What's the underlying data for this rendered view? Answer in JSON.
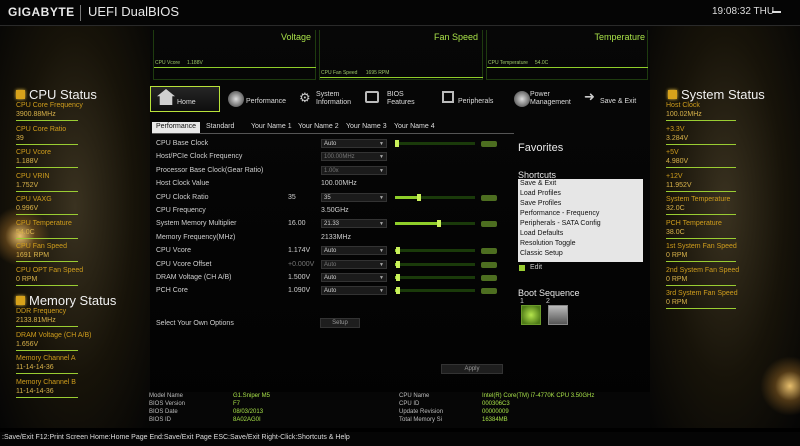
{
  "header": {
    "brand": "GIGABYTE",
    "product": "UEFI DualBIOS",
    "clock": "19:08:32 THU"
  },
  "graphs": {
    "voltage": {
      "title": "Voltage",
      "label": "CPU Vcore",
      "value": "1.188V"
    },
    "fan_speed": {
      "title": "Fan Speed",
      "label": "CPU Fan Speed",
      "value": "1695 RPM"
    },
    "temperature": {
      "title": "Temperature",
      "label": "CPU Temperature",
      "value": "54.0C"
    }
  },
  "nav": {
    "home": "Home",
    "performance": "Performance",
    "system_information": "System Information",
    "bios_features": "BIOS Features",
    "peripherals": "Peripherals",
    "power_management": "Power Management",
    "save_exit": "Save & Exit"
  },
  "subtabs": [
    "Performance",
    "Standard",
    "Your Name 1",
    "Your Name 2",
    "Your Name 3",
    "Your Name 4"
  ],
  "cpu_status": {
    "title": "CPU Status",
    "items": [
      {
        "label": "CPU Core Frequency",
        "value": "3900.88MHz"
      },
      {
        "label": "CPU Core Ratio",
        "value": "39"
      },
      {
        "label": "CPU Vcore",
        "value": "1.188V"
      },
      {
        "label": "CPU VRIN",
        "value": "1.752V"
      },
      {
        "label": "CPU VAXG",
        "value": "0.996V"
      },
      {
        "label": "CPU Temperature",
        "value": "54.0C"
      },
      {
        "label": "CPU Fan Speed",
        "value": "1691 RPM"
      },
      {
        "label": "CPU OPT Fan Speed",
        "value": "0 RPM"
      }
    ]
  },
  "memory_status": {
    "title": "Memory Status",
    "items": [
      {
        "label": "DDR Frequency",
        "value": "2133.81MHz"
      },
      {
        "label": "DRAM Voltage      (CH A/B)",
        "value": "1.656V"
      },
      {
        "label": "Memory Channel A",
        "value": "11-14-14-36"
      },
      {
        "label": "Memory Channel B",
        "value": "11-14-14-36"
      }
    ]
  },
  "system_status": {
    "title": "System Status",
    "items": [
      {
        "label": "Host Clock",
        "value": "100.02MHz"
      },
      {
        "label": "+3.3V",
        "value": "3.284V"
      },
      {
        "label": "+5V",
        "value": "4.980V"
      },
      {
        "label": "+12V",
        "value": "11.952V"
      },
      {
        "label": "System Temperature",
        "value": "32.0C"
      },
      {
        "label": "PCH Temperature",
        "value": "38.0C"
      },
      {
        "label": "1st System Fan Speed",
        "value": "0 RPM"
      },
      {
        "label": "2nd System Fan Speed",
        "value": "0 RPM"
      },
      {
        "label": "3rd System Fan Speed",
        "value": "0 RPM"
      }
    ]
  },
  "settings": [
    {
      "label": "CPU Base Clock",
      "current": "",
      "select": "Auto",
      "dim": false,
      "slider": 0.03
    },
    {
      "label": "Host/PCIe Clock Frequency",
      "current": "",
      "select": "100.00MHz",
      "dim": true,
      "slider": null
    },
    {
      "label": "Processor Base Clock(Gear Ratio)",
      "current": "",
      "select": "1.00x",
      "dim": true,
      "slider": null
    },
    {
      "label": "Host Clock Value",
      "current": "",
      "value": "100.00MHz",
      "dim": false,
      "slider": null
    },
    {
      "label": "CPU Clock Ratio",
      "current": "35",
      "select": "35",
      "dim": false,
      "slider": 0.3
    },
    {
      "label": "CPU Frequency",
      "current": "",
      "value": "3.50GHz",
      "dim": false,
      "slider": null
    },
    {
      "label": "System Memory Multiplier",
      "current": "16.00",
      "select": "21.33",
      "dim": false,
      "slider": 0.55
    },
    {
      "label": "Memory Frequency(MHz)",
      "current": "",
      "value": "2133MHz",
      "dim": false,
      "slider": null
    },
    {
      "label": "CPU Vcore",
      "current": "1.174V",
      "select": "Auto",
      "dim": false,
      "slider": 0.04
    },
    {
      "label": "CPU Vcore Offset",
      "current": "+0.000V",
      "select": "Auto",
      "dim": true,
      "slider": 0.04
    },
    {
      "label": "DRAM Voltage     (CH A/B)",
      "current": "1.500V",
      "select": "Auto",
      "dim": false,
      "slider": 0.04
    },
    {
      "label": "PCH Core",
      "current": "1.090V",
      "select": "Auto",
      "dim": false,
      "slider": 0.04
    }
  ],
  "own_options": {
    "label": "Select Your Own Options",
    "button": "Setup"
  },
  "apply_button": "Apply",
  "favorites": {
    "title": "Favorites",
    "shortcuts_title": "Shortcuts",
    "shortcuts": [
      "Save & Exit",
      "Load Profiles",
      "Save Profiles",
      "Performance - Frequency",
      "Peripherals - SATA Config",
      "Load Defaults",
      "Resolution Toggle",
      "Classic Setup"
    ],
    "edit_label": "Edit",
    "boot_title": "Boot Sequence",
    "boot_numbers": [
      "1",
      "2"
    ]
  },
  "info": {
    "left": [
      {
        "label": "Model Name",
        "value": "G1.Sniper M5"
      },
      {
        "label": "BIOS Version",
        "value": "F7"
      },
      {
        "label": "BIOS Date",
        "value": "08/03/2013"
      },
      {
        "label": "BIOS ID",
        "value": "8A02AG0I"
      }
    ],
    "right": [
      {
        "label": "CPU Name",
        "value": "Intel(R) Core(TM) i7-4770K CPU  3.50GHz"
      },
      {
        "label": "CPU ID",
        "value": "000306C3"
      },
      {
        "label": "Update Revision",
        "value": "00000009"
      },
      {
        "label": "Total Memory Si",
        "value": "16384MB"
      }
    ]
  },
  "helpbar": ":Save/Exit F12:Print Screen Home:Home Page End:Save/Exit Page ESC:Save/Exit Right-Click:Shortcuts & Help",
  "colors": {
    "accent": "#9acd32",
    "gold": "#cf9d1c",
    "background": "#000000"
  }
}
